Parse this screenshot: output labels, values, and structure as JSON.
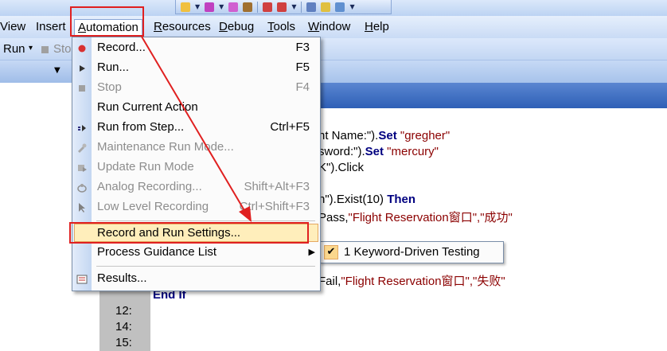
{
  "menubar": {
    "items": [
      {
        "label": "View",
        "mnemonic": ""
      },
      {
        "label": "Insert",
        "mnemonic": ""
      },
      {
        "label": "Automation",
        "mnemonic": "A"
      },
      {
        "label": "Resources",
        "mnemonic": "R"
      },
      {
        "label": "Debug",
        "mnemonic": "D"
      },
      {
        "label": "Tools",
        "mnemonic": "T"
      },
      {
        "label": "Window",
        "mnemonic": "W"
      },
      {
        "label": "Help",
        "mnemonic": "H"
      }
    ]
  },
  "runbar": {
    "run_label": "Run",
    "stop_label": "Sto"
  },
  "automation_menu": {
    "items": [
      {
        "label": "Record...",
        "shortcut": "F3",
        "enabled": true,
        "icon": "record-icon"
      },
      {
        "label": "Run...",
        "shortcut": "F5",
        "enabled": true,
        "icon": "run-icon"
      },
      {
        "label": "Stop",
        "shortcut": "F4",
        "enabled": false,
        "icon": "stop-icon"
      },
      {
        "label": "Run Current Action",
        "shortcut": "",
        "enabled": true,
        "icon": ""
      },
      {
        "label": "Run from Step...",
        "shortcut": "Ctrl+F5",
        "enabled": true,
        "icon": "run-from-step-icon"
      },
      {
        "label": "Maintenance Run Mode...",
        "shortcut": "",
        "enabled": false,
        "icon": "maintenance-icon"
      },
      {
        "label": "Update Run Mode",
        "shortcut": "",
        "enabled": false,
        "icon": "update-run-icon"
      },
      {
        "label": "Analog Recording...",
        "shortcut": "Shift+Alt+F3",
        "enabled": false,
        "icon": "analog-recording-icon"
      },
      {
        "label": "Low Level Recording",
        "shortcut": "Ctrl+Shift+F3",
        "enabled": false,
        "icon": "low-level-recording-icon"
      },
      {
        "label": "Record and Run Settings...",
        "shortcut": "",
        "enabled": true,
        "icon": ""
      },
      {
        "label": "Process Guidance List",
        "shortcut": "",
        "enabled": true,
        "icon": ""
      },
      {
        "label": "Results...",
        "shortcut": "",
        "enabled": true,
        "icon": "results-icon"
      }
    ]
  },
  "submenu": {
    "item_label": "1 Keyword-Driven Testing"
  },
  "code": {
    "line1_prefix": "nt Name:\").",
    "line1_kw": "Set",
    "line1_str": " \"gregher\"",
    "line2_prefix": "sword:\").",
    "line2_kw": "Set",
    "line2_str": " \"mercury\"",
    "line3": "K\").Click",
    "line4_prefix": "n\").Exist(10) ",
    "line4_kw": "Then",
    "line5_prefix": "Pass,",
    "line5_str": "\"Flight Reservation窗口\",\"成功\"",
    "line6_prefix": "Fail,",
    "line6_str": "\"Flight Reservation窗口\",\"失败\"",
    "line7_kw": "End If"
  },
  "line_numbers": [
    "12:",
    "14:",
    "15:"
  ],
  "colors": {
    "highlight": "#ffeebb",
    "annotation_red": "#e02020",
    "keyword": "#000080",
    "string": "#8b0000"
  }
}
